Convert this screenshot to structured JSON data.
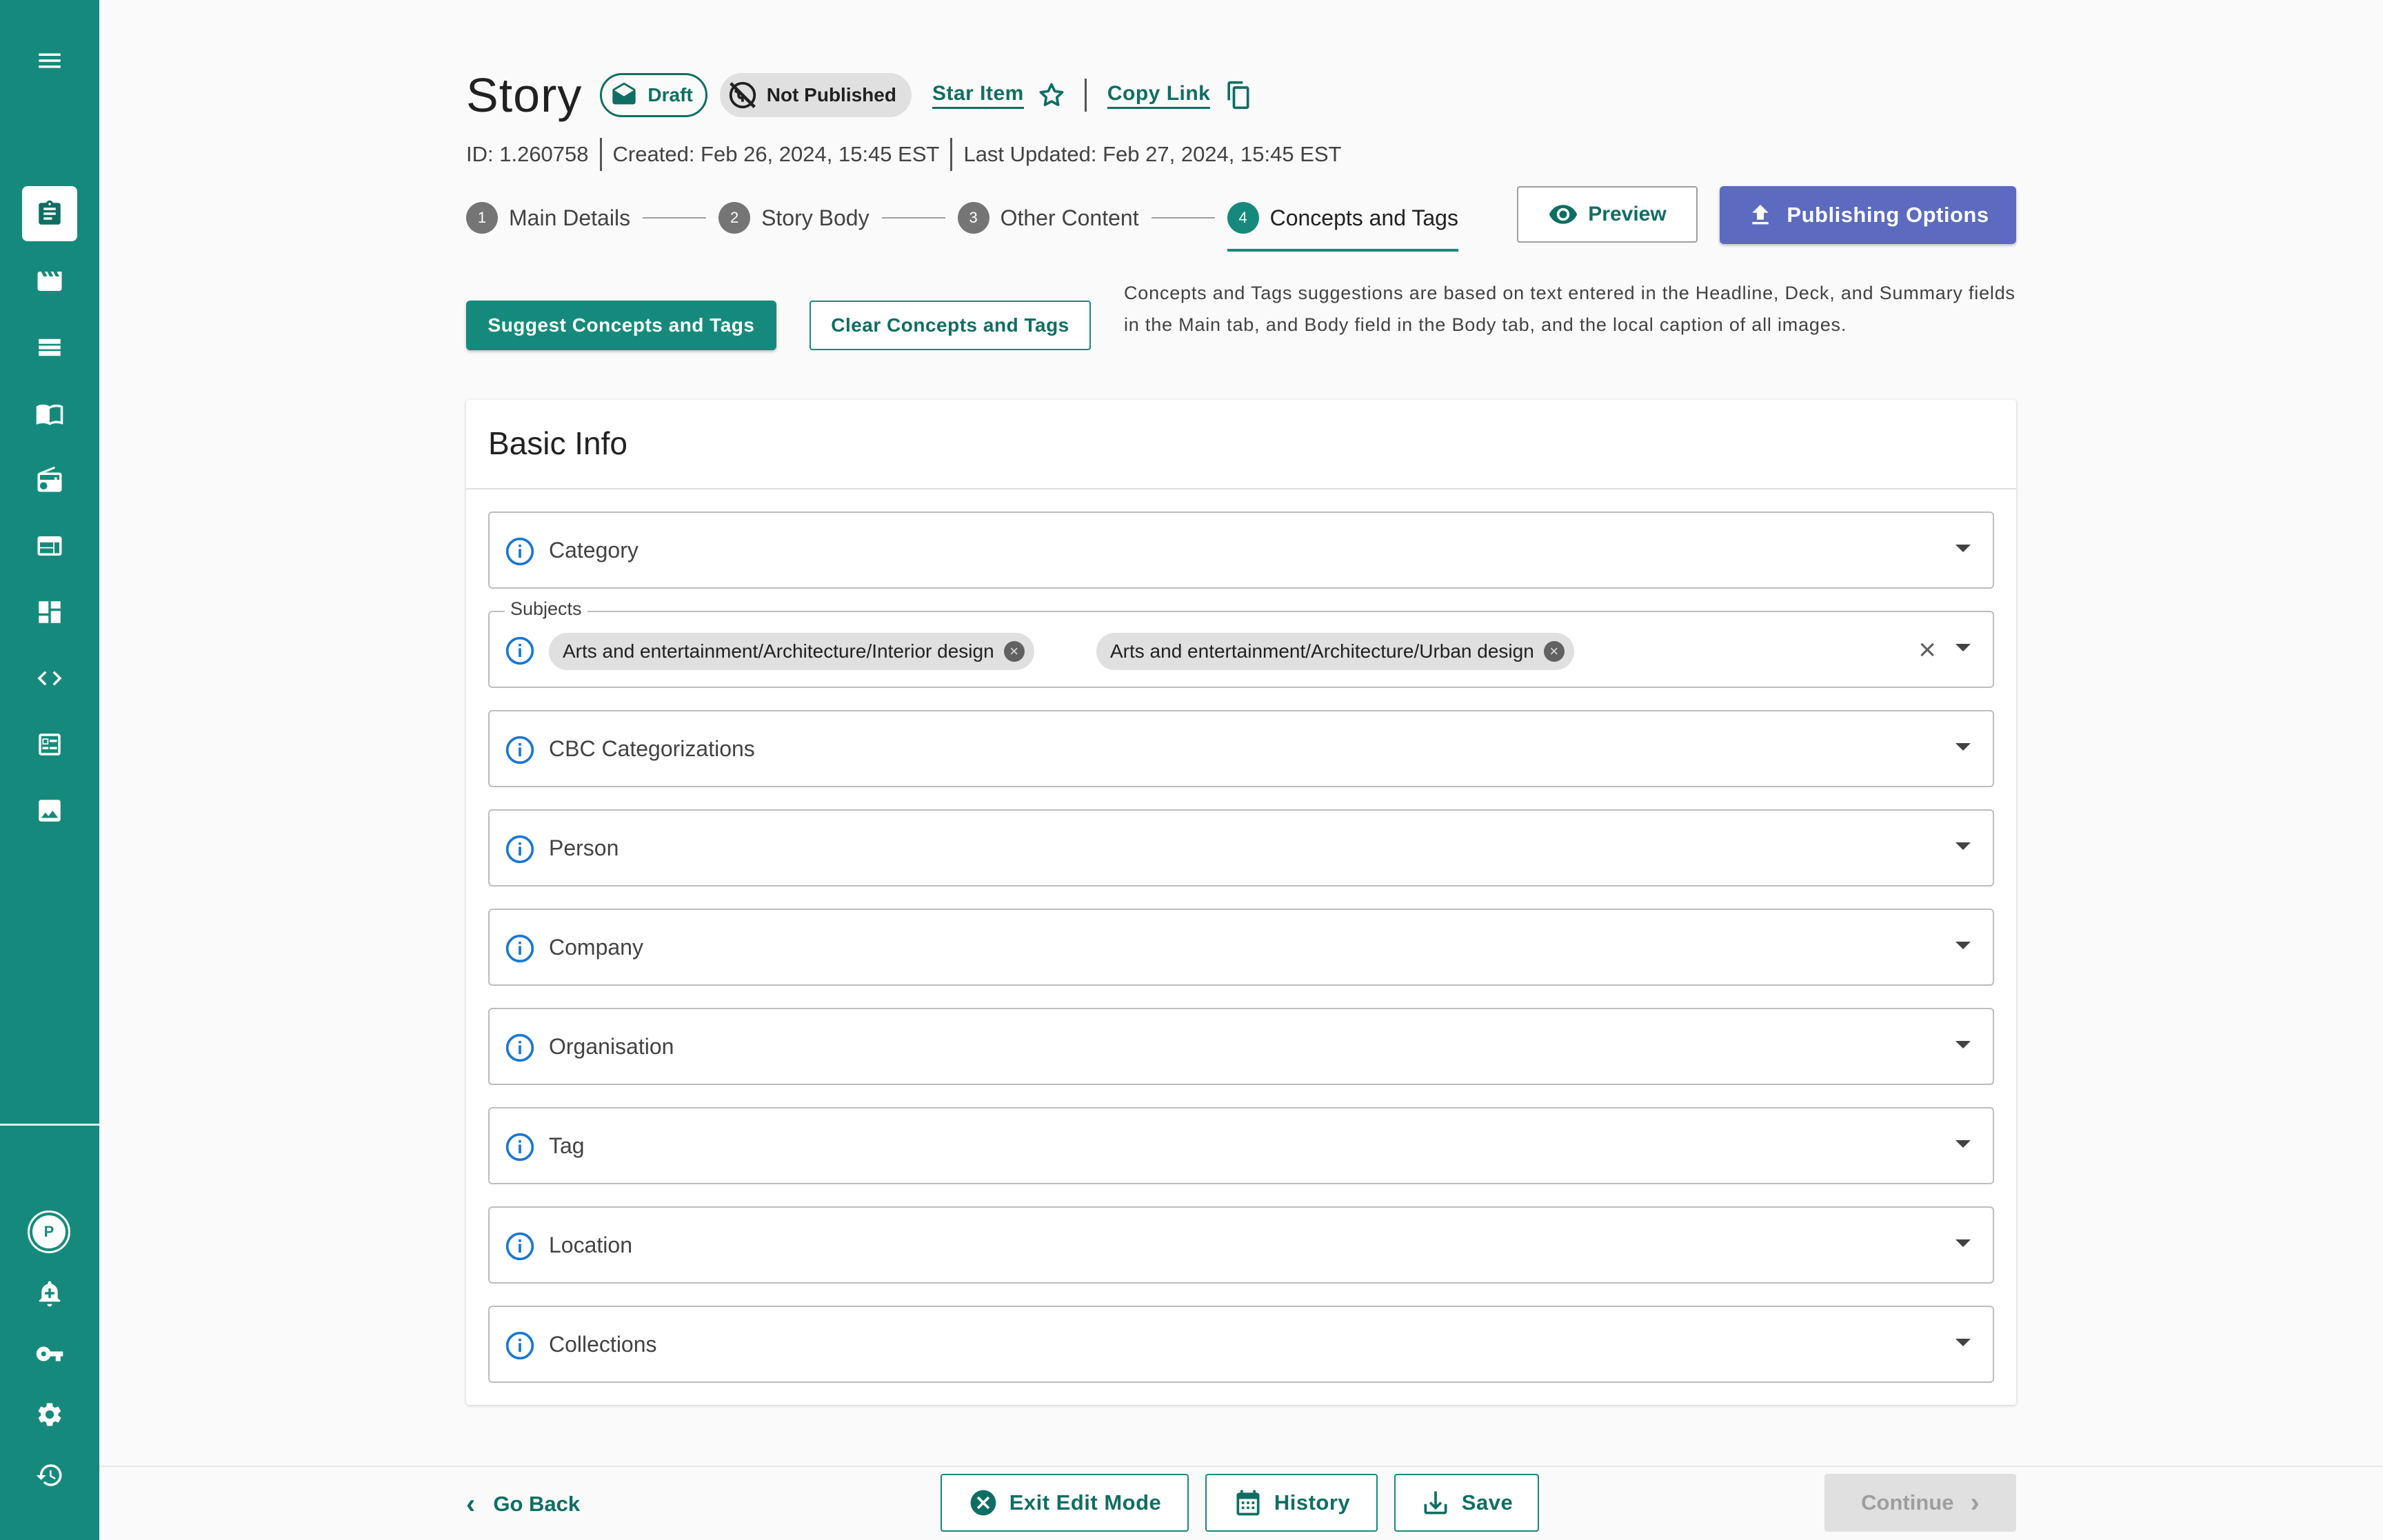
{
  "header": {
    "title": "Story",
    "status_chip": "Draft",
    "publish_chip": "Not Published",
    "star_label": "Star Item",
    "copy_label": "Copy Link"
  },
  "meta": {
    "id": "ID: 1.260758",
    "created": "Created: Feb 26, 2024, 15:45 EST",
    "updated": "Last Updated: Feb 27, 2024, 15:45 EST"
  },
  "stepper": {
    "steps": [
      {
        "num": "1",
        "label": "Main Details"
      },
      {
        "num": "2",
        "label": "Story Body"
      },
      {
        "num": "3",
        "label": "Other Content"
      },
      {
        "num": "4",
        "label": "Concepts and Tags"
      }
    ],
    "preview_label": "Preview",
    "publishing_label": "Publishing Options"
  },
  "actions": {
    "suggest_label": "Suggest Concepts and Tags",
    "clear_label": "Clear Concepts and Tags",
    "hint": "Concepts and Tags suggestions are based on text entered in the Headline, Deck, and Summary fields in the Main tab, and Body field in the Body tab, and the local caption of all images."
  },
  "card": {
    "title": "Basic Info",
    "subjects": {
      "legend": "Subjects",
      "chips": [
        "Arts and entertainment/Architecture/Interior design",
        "Arts and entertainment/Architecture/Urban design"
      ]
    },
    "fields": [
      "Category",
      "CBC Categorizations",
      "Person",
      "Company",
      "Organisation",
      "Tag",
      "Location",
      "Collections"
    ]
  },
  "sidebar": {
    "avatar": "P"
  },
  "footer": {
    "back_label": "Go Back",
    "exit_label": "Exit Edit Mode",
    "history_label": "History",
    "save_label": "Save",
    "continue_label": "Continue"
  },
  "colors": {
    "sidebar": "#158a7c",
    "accent": "#0f6e63",
    "publish": "#5c6bc0"
  }
}
